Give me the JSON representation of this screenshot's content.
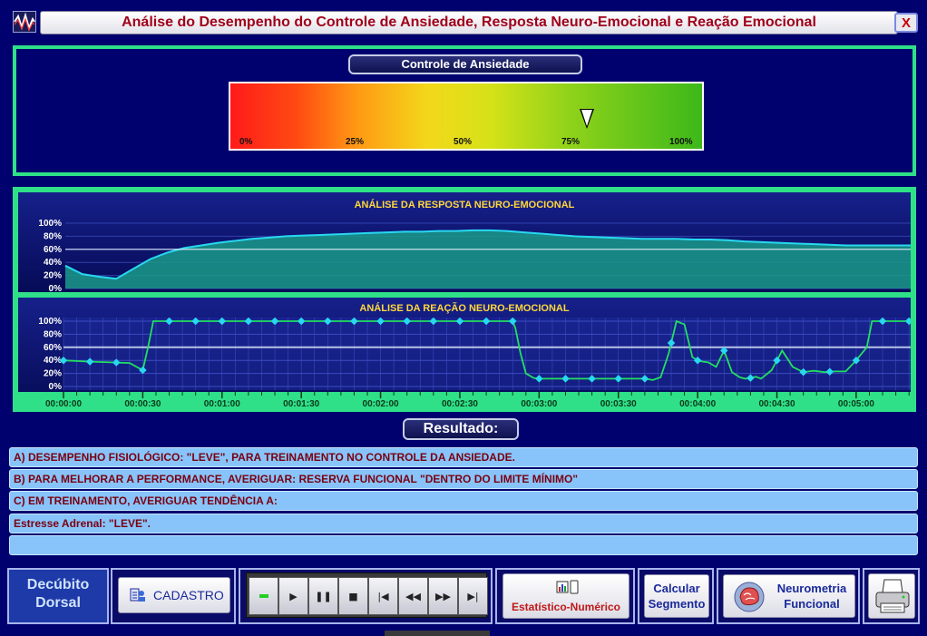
{
  "window": {
    "title": "Análise do Desempenho do Controle de Ansiedade, Resposta Neuro-Emocional e Reação Emocional",
    "close_label": "X"
  },
  "gauge": {
    "title": "Controle de Ansiedade",
    "ticks": [
      "0%",
      "25%",
      "50%",
      "75%",
      "100%"
    ],
    "value_percent": 78
  },
  "chart_data": [
    {
      "type": "area",
      "title": "ANÁLISE DA RESPOSTA NEURO-EMOCIONAL",
      "y_ticks": [
        "100%",
        "80%",
        "60%",
        "40%",
        "20%",
        "0%"
      ],
      "ylim": [
        0,
        100
      ],
      "series": [
        {
          "values": [
            35,
            22,
            18,
            15,
            30,
            45,
            55,
            62,
            66,
            70,
            73,
            76,
            78,
            80,
            81,
            82,
            83,
            84,
            85,
            86,
            87,
            87,
            88,
            88,
            89,
            89,
            88,
            86,
            84,
            82,
            80,
            79,
            78,
            77,
            76,
            76,
            76,
            75,
            75,
            74,
            72,
            71,
            70,
            69,
            68,
            67,
            66,
            66,
            66,
            66,
            66
          ]
        }
      ],
      "reference_line": 60
    },
    {
      "type": "line",
      "title": "ANÁLISE DA REAÇÃO NEURO-EMOCIONAL",
      "y_ticks": [
        "100%",
        "80%",
        "60%",
        "40%",
        "20%",
        "0%"
      ],
      "ylim": [
        0,
        100
      ],
      "x_tick_labels": [
        "00:00:00",
        "00:00:30",
        "00:01:00",
        "00:01:30",
        "00:02:00",
        "00:02:30",
        "00:03:00",
        "00:03:30",
        "00:04:00",
        "00:04:30",
        "00:05:00"
      ],
      "x_range_seconds": [
        0,
        322
      ],
      "series": [
        {
          "t": [
            0,
            10,
            18,
            25,
            30,
            32,
            34,
            40,
            50,
            60,
            70,
            80,
            90,
            100,
            110,
            120,
            130,
            140,
            150,
            160,
            170,
            171,
            173,
            175,
            178,
            180,
            190,
            200,
            210,
            220,
            223,
            226,
            229,
            232,
            235,
            238,
            240,
            242,
            244,
            247,
            250,
            253,
            256,
            258,
            260,
            262,
            264,
            268,
            272,
            276,
            280,
            282,
            284,
            288,
            292,
            296,
            300,
            304,
            306,
            308,
            310,
            312,
            318,
            322
          ],
          "values": [
            40,
            38,
            37,
            36,
            25,
            60,
            100,
            100,
            100,
            100,
            100,
            100,
            100,
            100,
            100,
            100,
            100,
            100,
            100,
            100,
            100,
            90,
            50,
            20,
            13,
            12,
            12,
            12,
            12,
            12,
            10,
            14,
            50,
            100,
            95,
            45,
            40,
            38,
            37,
            30,
            55,
            22,
            14,
            12,
            13,
            15,
            12,
            25,
            55,
            30,
            22,
            23,
            24,
            22,
            23,
            23,
            40,
            60,
            100,
            100,
            100,
            100,
            100,
            100
          ]
        }
      ],
      "reference_line": 60
    }
  ],
  "results": {
    "label": "Resultado:",
    "lines": [
      "A) DESEMPENHO FISIOLÓGICO: \"LEVE\", PARA TREINAMENTO NO CONTROLE DA ANSIEDADE.",
      "B) PARA MELHORAR A PERFORMANCE, AVERIGUAR: RESERVA FUNCIONAL \"DENTRO DO LIMITE MÍNIMO\"",
      "C) EM TREINAMENTO, AVERIGUAR TENDÊNCIA A:",
      "Estresse Adrenal: \"LEVE\".",
      ""
    ]
  },
  "toolbar": {
    "position_line1": "Decúbito",
    "position_line2": "Dorsal",
    "cadastro": "CADASTRO",
    "media": [
      "",
      "▶",
      "❚❚",
      "■",
      "|◀",
      "◀◀",
      "▶▶",
      "▶|"
    ],
    "stat_label": "Estatístico-Numérico",
    "calc_line1": "Calcular",
    "calc_line2": "Segmento",
    "neuro_line1": "Neurometria",
    "neuro_line2": "Funcional"
  },
  "colors": {
    "background": "#00006e",
    "panel_border": "#2fe088",
    "title_text": "#a0001a",
    "chart_title": "#ffd83a",
    "area_fill": "#1a9a88",
    "line_cyan": "#28d8f0",
    "line_green": "#22e060",
    "result_row": "#88c4fa"
  }
}
